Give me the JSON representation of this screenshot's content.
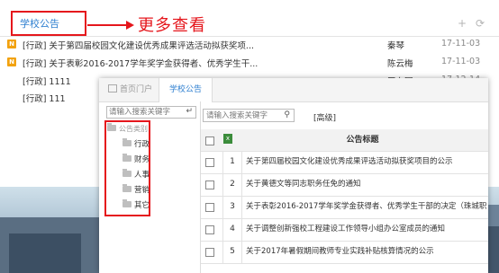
{
  "background": {
    "tab_label": "学校公告",
    "annotation": "更多查看",
    "news": [
      {
        "badge": "N",
        "title": "[行政] 关于第四届校园文化建设优秀成果评选活动拟获奖项...",
        "author": "秦琴",
        "date": "17-11-03"
      },
      {
        "badge": "N",
        "title": "[行政] 关于表彰2016-2017学年奖学金获得者、优秀学生干...",
        "author": "陈云梅",
        "date": "17-11-03"
      },
      {
        "badge": "",
        "title": "[行政] 1111",
        "author": "王东园",
        "date": "17-12-14"
      },
      {
        "badge": "",
        "title": "[行政] 111",
        "author": "",
        "date": ""
      }
    ]
  },
  "dialog": {
    "tabs": [
      "首页门户",
      "学校公告"
    ],
    "left_search_placeholder": "请输入搜索关键字",
    "tree_root": "公告类别",
    "categories": [
      "行政",
      "财务",
      "人事",
      "营销",
      "其它"
    ],
    "right_search_placeholder": "请输入搜索关键字",
    "advanced_label": "[高级]",
    "grid": {
      "header_title": "公告标题",
      "rows": [
        {
          "num": "1",
          "title": "关于第四届校园文化建设优秀成果评选活动拟获奖项目的公示"
        },
        {
          "num": "2",
          "title": "关于黄德文等同志职务任免的通知"
        },
        {
          "num": "3",
          "title": "关于表彰2016-2017学年奖学金获得者、优秀学生干部的决定（珠城职"
        },
        {
          "num": "4",
          "title": "关于调整创新强校工程建设工作领导小组办公室成员的通知"
        },
        {
          "num": "5",
          "title": "关于2017年暑假期间教师专业实践补贴核算情况的公示"
        }
      ]
    }
  },
  "colors": {
    "accent": "#2e7fd0",
    "highlight": "#e5161c",
    "badge": "#f2a20f"
  }
}
